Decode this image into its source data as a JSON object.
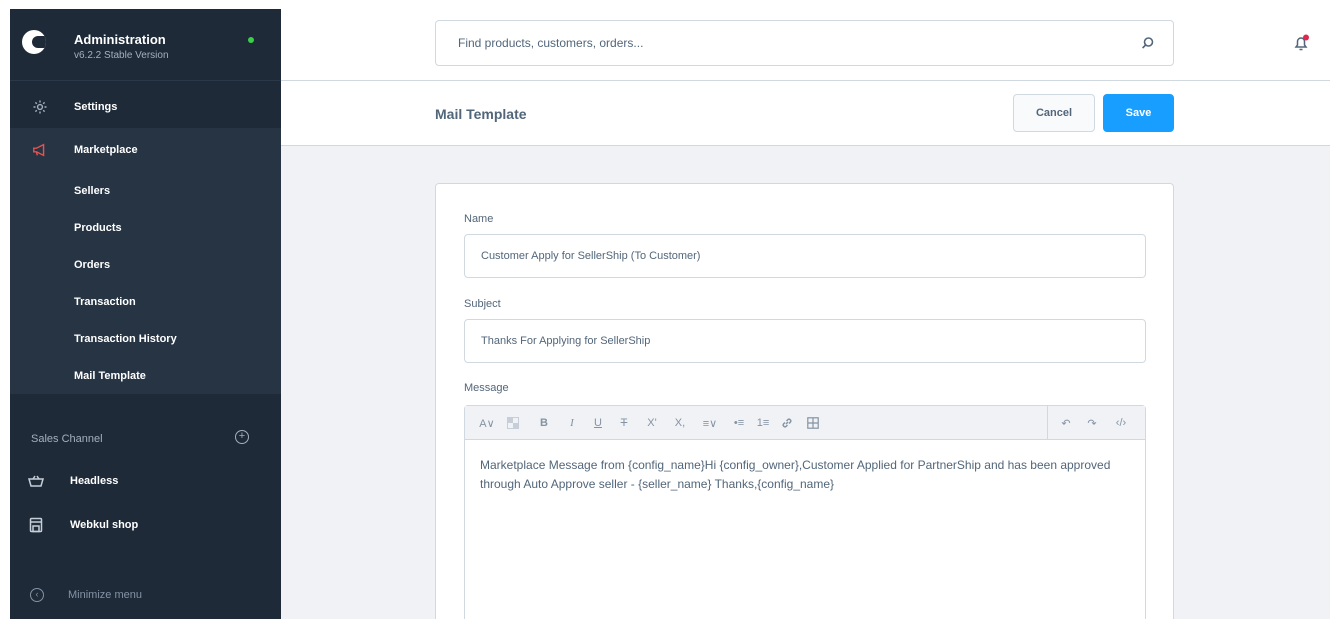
{
  "sidebar": {
    "app_title": "Administration",
    "app_version": "v6.2.2 Stable Version",
    "settings_label": "Settings",
    "marketplace_label": "Marketplace",
    "submenu": [
      "Sellers",
      "Products",
      "Orders",
      "Transaction",
      "Transaction History",
      "Mail Template"
    ],
    "sales_channel_title": "Sales Channel",
    "channels": [
      "Headless",
      "Webkul shop"
    ],
    "minimize_label": "Minimize menu"
  },
  "search": {
    "placeholder": "Find products, customers, orders..."
  },
  "smartbar": {
    "title": "Mail Template",
    "cancel_label": "Cancel",
    "save_label": "Save"
  },
  "form": {
    "name_label": "Name",
    "name_value": "Customer Apply for SellerShip (To Customer)",
    "subject_label": "Subject",
    "subject_value": "Thanks For Applying for SellerShip",
    "message_label": "Message",
    "message_value": "Marketplace Message from {config_name}Hi {config_owner},Customer Applied for PartnerShip and has been approved through Auto Approve seller -  {seller_name} Thanks,{config_name}"
  },
  "colors": {
    "sidebar_bg": "#1e2a38",
    "submenu_bg": "#263444",
    "accent": "#189eff",
    "online": "#37d046",
    "marketplace_icon": "#e8514f",
    "notification_dot": "#de294c"
  }
}
